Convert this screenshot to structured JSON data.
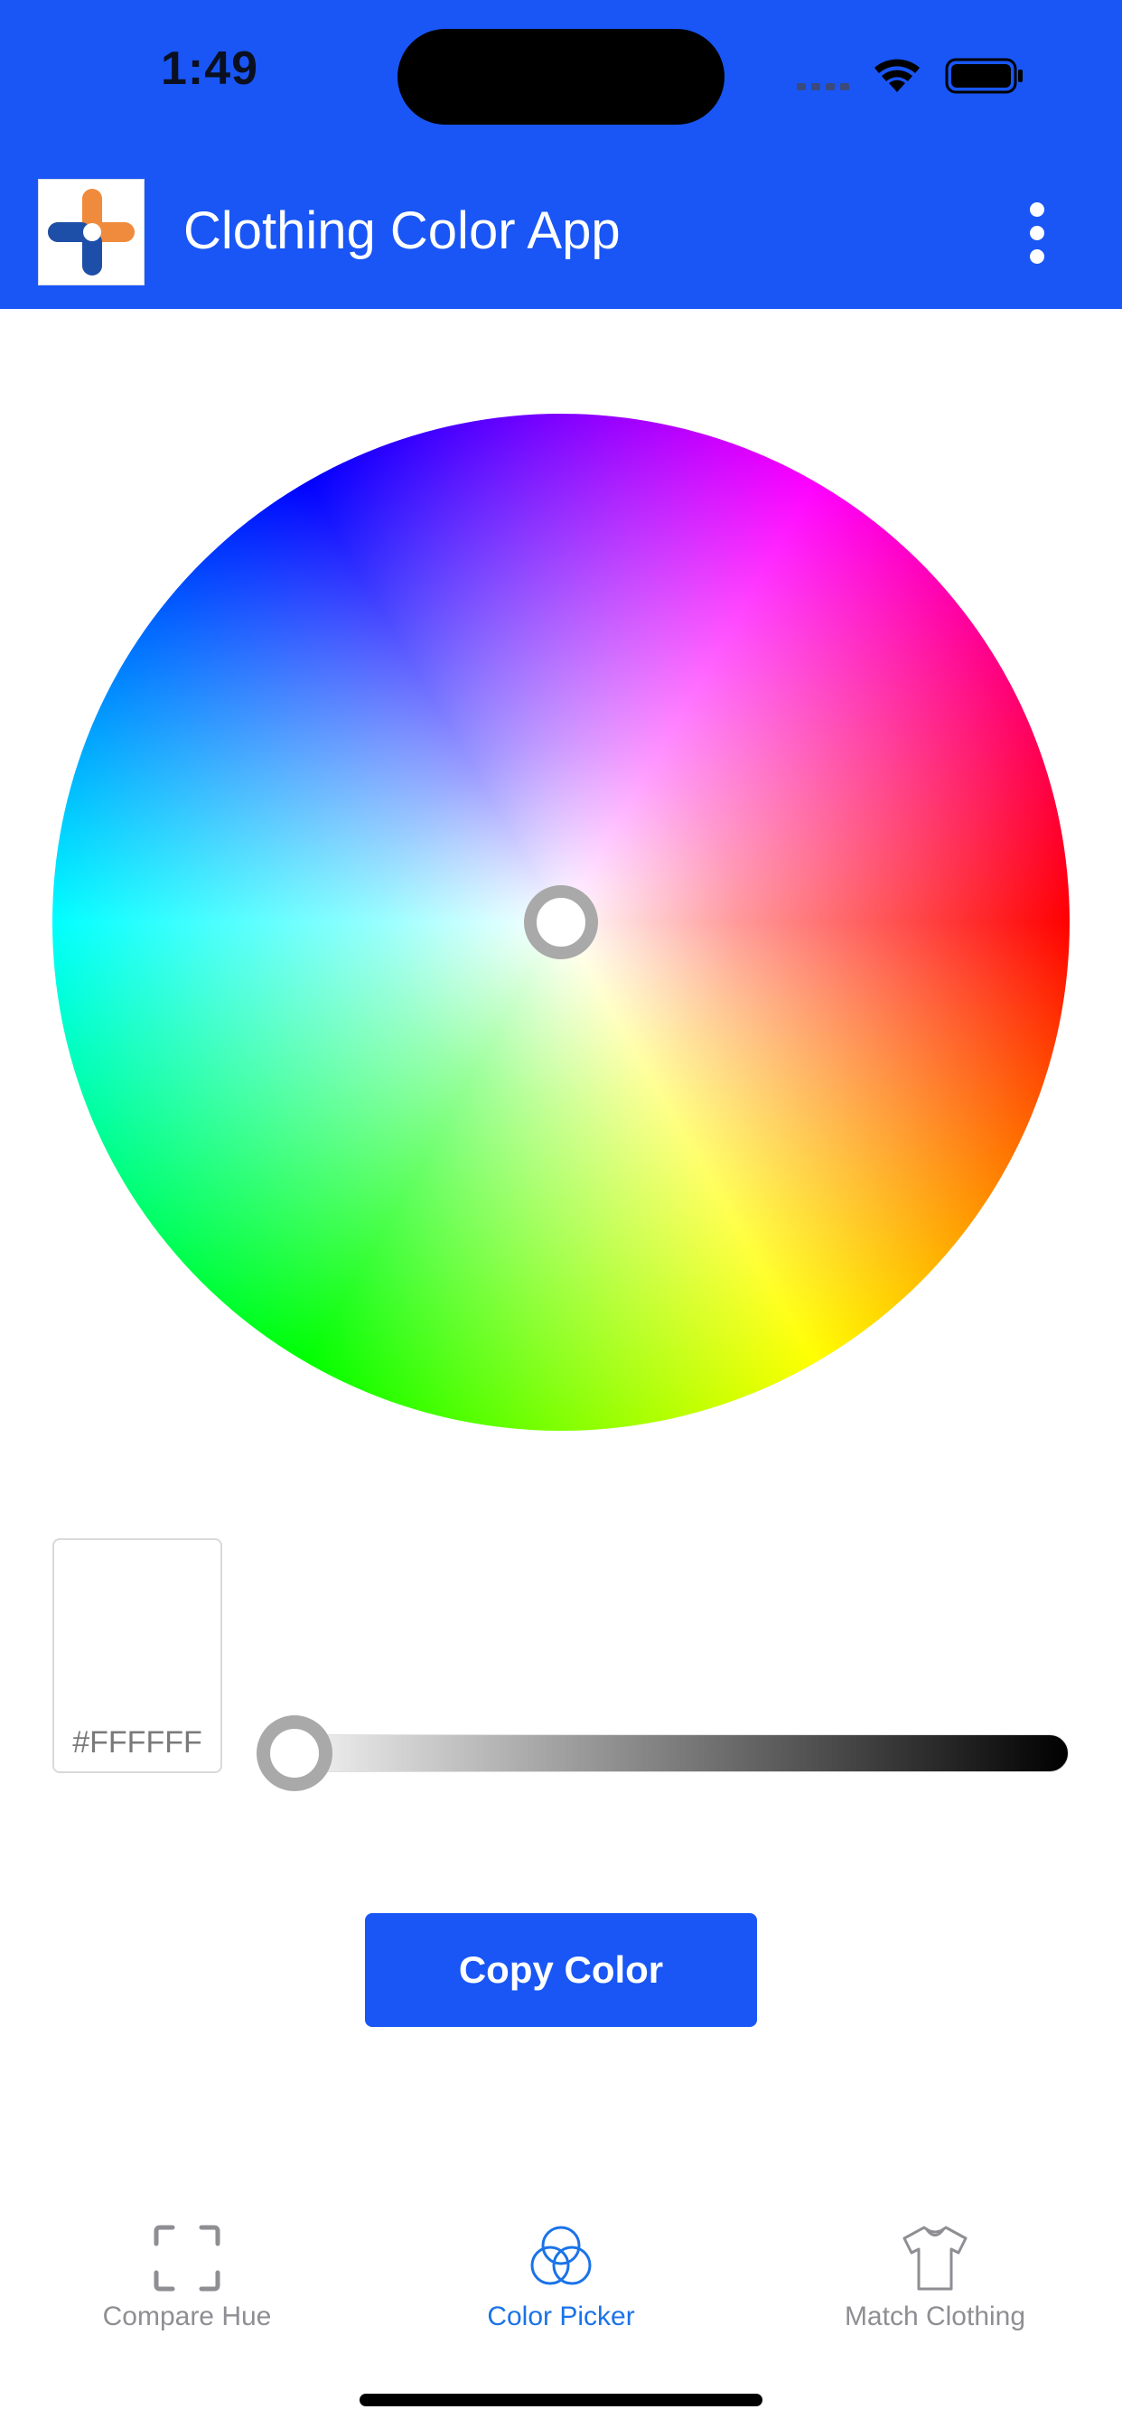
{
  "status_bar": {
    "time": "1:49"
  },
  "app_bar": {
    "title": "Clothing Color App",
    "logo_icon": "app-logo-cross-icon",
    "menu_icon": "more-vertical-icon"
  },
  "picker": {
    "hex_value": "#FFFFFF",
    "brightness_fraction": 0.0
  },
  "actions": {
    "copy_label": "Copy Color"
  },
  "tabs": [
    {
      "label": "Compare Hue",
      "icon": "viewfinder-icon",
      "active": false
    },
    {
      "label": "Color Picker",
      "icon": "color-circles-icon",
      "active": true
    },
    {
      "label": "Match Clothing",
      "icon": "tshirt-icon",
      "active": false
    }
  ],
  "colors": {
    "primary": "#1956F5",
    "active_tab": "#1a73e8",
    "inactive_tab": "#8e8e93",
    "selected_color": "#FFFFFF"
  }
}
